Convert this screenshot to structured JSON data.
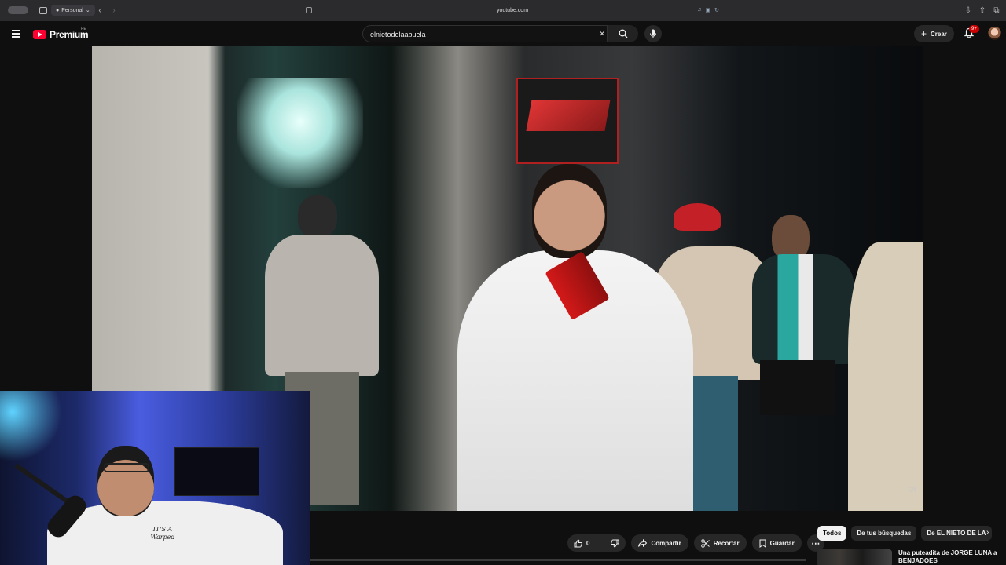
{
  "browser": {
    "profile_label": "Personal",
    "url": "youtube.com"
  },
  "header": {
    "logo_text": "Premium",
    "logo_country": "PE",
    "search_value": "elnietodelaabuela",
    "create_label": "Crear",
    "notification_badge": "9+"
  },
  "video": {
    "watermark": "SM"
  },
  "webcam": {
    "shirt_text": "IT'S A Warped"
  },
  "actions": {
    "like_count": "0",
    "share_label": "Compartir",
    "clip_label": "Recortar",
    "save_label": "Guardar",
    "more_label": "⋯"
  },
  "chips": [
    {
      "label": "Todos",
      "active": true
    },
    {
      "label": "De tus búsquedas",
      "active": false
    },
    {
      "label": "De EL NIETO DE LA",
      "active": false
    }
  ],
  "recommendation": {
    "title": "Una puteadita de JORGE LUNA a BENJADOES"
  },
  "colors": {
    "background": "#0f0f0f",
    "brand_red": "#ff0033",
    "pill": "#272727",
    "badge": "#cc0000"
  }
}
